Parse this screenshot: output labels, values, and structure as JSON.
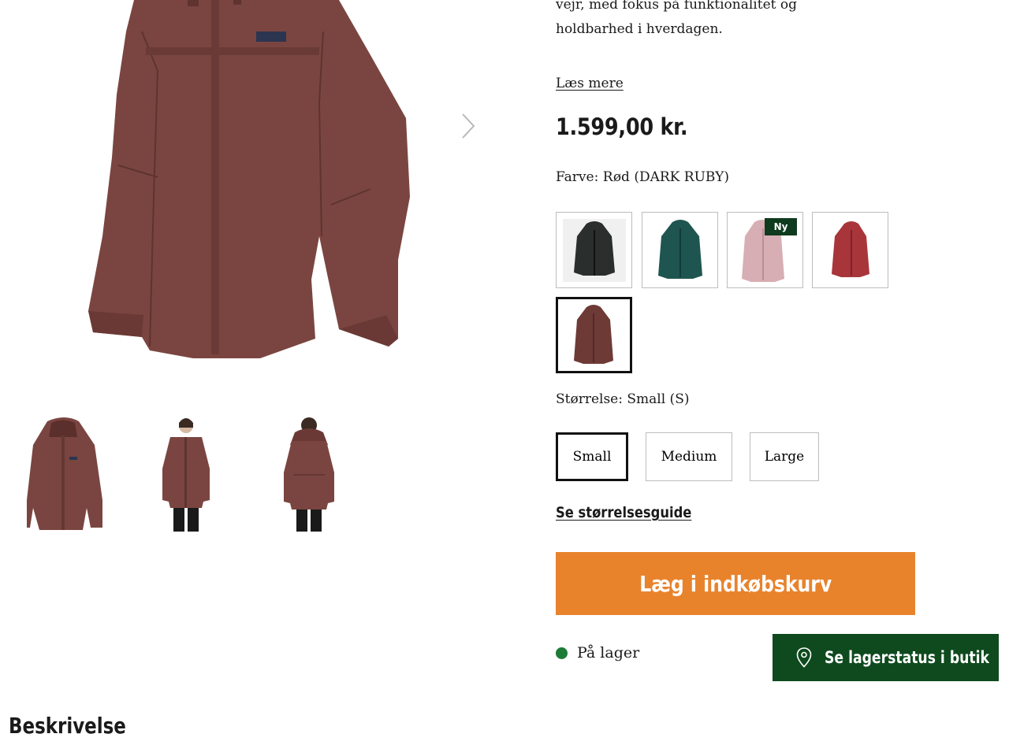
{
  "product": {
    "intro_line1": "vejr, med fokus på funktionalitet og",
    "intro_line2": "holdbarhed i hverdagen.",
    "read_more": "Læs mere",
    "price": "1.599,00 kr."
  },
  "color": {
    "label": "Farve: Rød (DARK RUBY)",
    "swatches": [
      {
        "shell": "#2a2e2d",
        "selected": false,
        "badge": ""
      },
      {
        "shell": "#1f5550",
        "selected": false,
        "badge": ""
      },
      {
        "shell": "#d7aeb3",
        "selected": false,
        "badge": "Ny"
      },
      {
        "shell": "#a8353a",
        "selected": false,
        "badge": ""
      },
      {
        "shell": "#6e3a36",
        "selected": true,
        "badge": ""
      }
    ]
  },
  "size": {
    "label": "Størrelse: Small (S)",
    "options": [
      "Small",
      "Medium",
      "Large"
    ],
    "selected": "Small",
    "guide_link": "Se størrelsesguide"
  },
  "actions": {
    "add_to_cart": "Læg i indkøbskurv",
    "stock_text": "På lager",
    "store_status": "Se lagerstatus i butik"
  },
  "sections": {
    "description_heading": "Beskrivelse"
  },
  "colors": {
    "accent_orange": "#e8832c",
    "dark_green": "#0e4a1e",
    "in_stock_green": "#1c7b37",
    "jacket_main": "#7a4540"
  }
}
